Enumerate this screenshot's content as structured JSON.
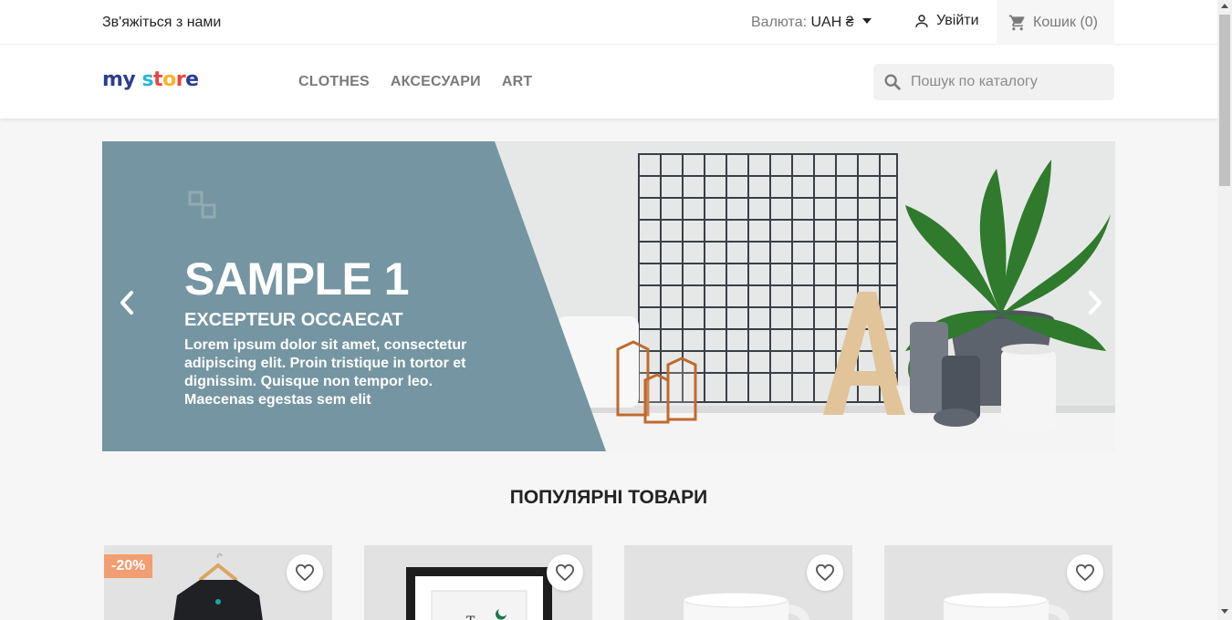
{
  "topbar": {
    "contact": "Зв'яжіться з нами",
    "currency_label": "Валюта:",
    "currency_value": "UAH ₴",
    "login": "Увійти",
    "cart": "Кошик (0)"
  },
  "header": {
    "logo_my": "my",
    "logo_store": "store",
    "nav": [
      "CLOTHES",
      "АКСЕСУАРИ",
      "ART"
    ],
    "search_placeholder": "Пошук по каталогу"
  },
  "slider": {
    "title": "SAMPLE 1",
    "subtitle": "EXCEPTEUR OCCAECAT",
    "description": "Lorem ipsum dolor sit amet, consectetur adipiscing elit. Proin tristique in tortor et dignissim. Quisque non tempor leo. Maecenas egestas sem elit"
  },
  "popular": {
    "title": "ПОПУЛЯРНІ ТОВАРИ",
    "products": [
      {
        "badge": "-20%",
        "image": "t-shirt"
      },
      {
        "badge": "",
        "image": "framed-poster"
      },
      {
        "badge": "",
        "image": "mug"
      },
      {
        "badge": "",
        "image": "mug"
      }
    ]
  },
  "colors": {
    "accent": "#24b9d7",
    "slide_panel": "#7495a1",
    "badge": "#f39d72"
  }
}
